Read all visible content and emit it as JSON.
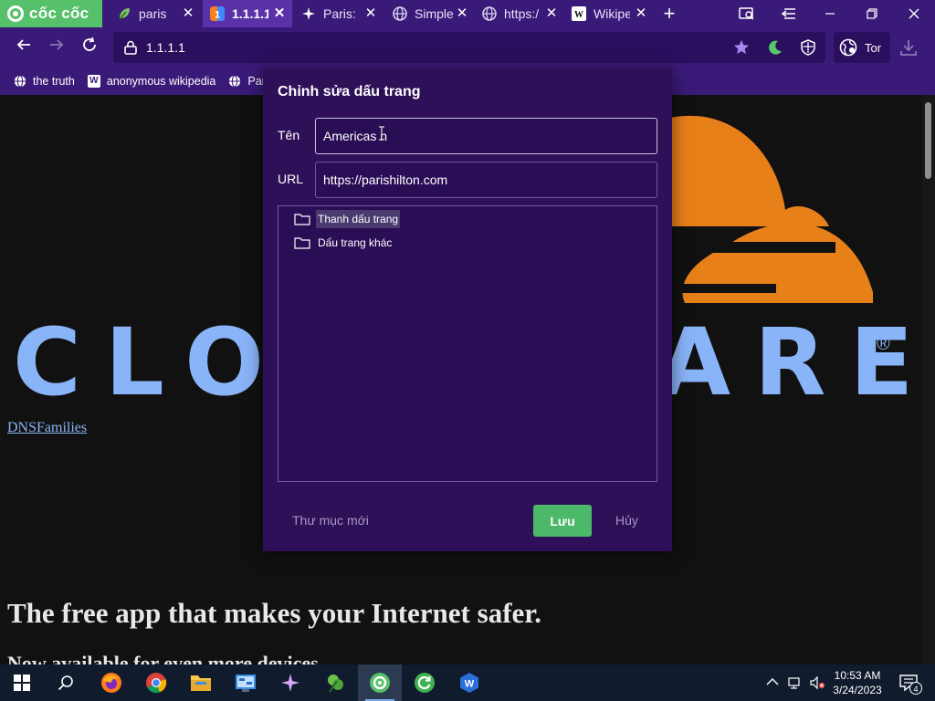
{
  "browser": {
    "brand": "cốc cốc",
    "tabs": [
      {
        "title": "paris h",
        "favicon": "leaf-icon",
        "active": false
      },
      {
        "title": "1.1.1.1",
        "favicon": "one-one-one-one-icon",
        "active": true
      },
      {
        "title": "Paris:",
        "favicon": "sparkle-icon",
        "active": false
      },
      {
        "title": "Simple",
        "favicon": "globe-icon",
        "active": false
      },
      {
        "title": "https:/",
        "favicon": "globe-icon",
        "active": false
      },
      {
        "title": "Wikipe",
        "favicon": "wikipedia-icon",
        "active": false
      }
    ],
    "address": "1.1.1.1",
    "tor_label": "Tor",
    "bookmarks_bar": [
      {
        "label": "the truth",
        "icon": "globe-icon"
      },
      {
        "label": "anonymous wikipedia",
        "icon": "wikipedia-icon"
      },
      {
        "label": "Par",
        "icon": "globe-icon"
      }
    ]
  },
  "page": {
    "wordmark": "CLOUDFLARE",
    "registered_mark": "®",
    "dns_families_link": "DNSFamilies",
    "headline": "The free app that makes your Internet safer.",
    "subheadline": "Now available for even more devices"
  },
  "dialog": {
    "title": "Chỉnh sửa dấu trang",
    "name_label": "Tên",
    "name_value": "Americas n",
    "url_label": "URL",
    "url_value": "https://parishilton.com",
    "folders": [
      {
        "label": "Thanh dấu trang",
        "selected": true
      },
      {
        "label": "Dấu trang khác",
        "selected": false
      }
    ],
    "new_folder_label": "Thư mục mới",
    "save_label": "Lưu",
    "cancel_label": "Hủy"
  },
  "taskbar": {
    "time": "10:53 AM",
    "date": "3/24/2023",
    "notification_count": "4",
    "apps": [
      "windows-start-icon",
      "search-icon",
      "firefox-icon",
      "chrome-icon",
      "file-explorer-icon",
      "control-panel-icon",
      "sparkle-app-icon",
      "green-leaf-app-icon",
      "coccoc-icon",
      "refresh-app-icon",
      "wps-icon"
    ]
  },
  "colors": {
    "chrome_purple": "#3a1a78",
    "dialog_bg": "#2d1058",
    "save_green": "#4cb86a",
    "cloudflare_orange": "#e8801a",
    "wordmark_blue": "#8ab4f8"
  }
}
